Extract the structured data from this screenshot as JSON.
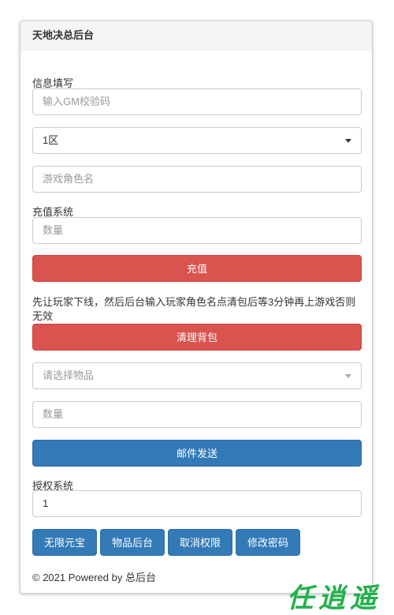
{
  "panel": {
    "title": "天地决总后台"
  },
  "info": {
    "label": "信息填写",
    "gm_code_placeholder": "输入GM校验码",
    "server_select": {
      "selected": "1区"
    },
    "role_placeholder": "游戏角色名"
  },
  "recharge": {
    "label": "充值系统",
    "amount_placeholder": "数量",
    "button": "充值"
  },
  "clear_bag": {
    "notice": "先让玩家下线，然后后台输入玩家角色名点清包后等3分钟再上游戏否则无效",
    "button": "清理背包"
  },
  "mail": {
    "item_select_placeholder": "请选择物品",
    "amount_placeholder": "数量",
    "button": "邮件发送"
  },
  "auth": {
    "label": "授权系统",
    "value": "1",
    "buttons": [
      "无限元宝",
      "物品后台",
      "取消权限",
      "修改密码"
    ]
  },
  "footer": {
    "text": "© 2021 Powered by 总后台"
  },
  "watermark": {
    "text": "任逍遥"
  },
  "colors": {
    "danger": "#d9534f",
    "primary": "#337ab7",
    "watermark": "#22b14c"
  }
}
